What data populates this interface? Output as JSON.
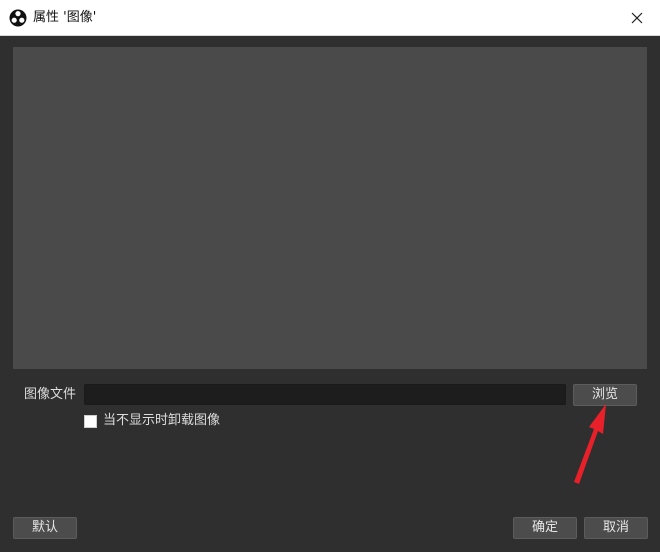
{
  "window": {
    "title": "属性 '图像'",
    "icon": "obs-logo-icon",
    "close_icon": "close-icon"
  },
  "image_file": {
    "label": "图像文件",
    "value": "",
    "browse_label": "浏览"
  },
  "unload_checkbox": {
    "label": "当不显示时卸载图像",
    "checked": false
  },
  "footer": {
    "defaults_label": "默认",
    "ok_label": "确定",
    "cancel_label": "取消"
  },
  "colors": {
    "background": "#2f2f2f",
    "preview": "#4a4a4a",
    "button": "#4c4c4c",
    "annotation_arrow": "#e8202a"
  }
}
